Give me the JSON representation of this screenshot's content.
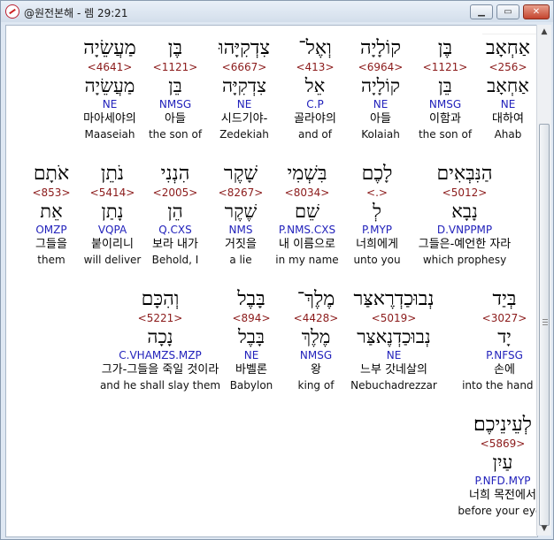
{
  "window": {
    "title": "@원전본해 - 렘 29:21",
    "min_glyph": "▁",
    "max_glyph": "▭",
    "close_glyph": "✕"
  },
  "scrollbar": {
    "up": "▲",
    "down": "▼"
  },
  "rows": [
    [
      {
        "heb": "אַחְאָב",
        "strong": "<256>",
        "lemma": "אַחְאָב",
        "parse": "NE",
        "kor": "대하여",
        "eng": "Ahab"
      },
      {
        "heb": "בֶּן",
        "strong": "<1121>",
        "lemma": "בֵּן",
        "parse": "NMSG",
        "kor": "이함과",
        "eng": "the son of"
      },
      {
        "heb": "קוֹלָיָה",
        "strong": "<6964>",
        "lemma": "קוֹלָיָה",
        "parse": "NE",
        "kor": "아들",
        "eng": "Kolaiah"
      },
      {
        "heb": "וְאֶל־",
        "strong": "<413>",
        "lemma": "אֵל",
        "parse": "C.P",
        "kor": "골라야의",
        "eng": "and of"
      },
      {
        "heb": "צִדְקִיָּהוּ",
        "strong": "<6667>",
        "lemma": "צִדְקִיָּה",
        "parse": "NE",
        "kor": "시드기야-",
        "eng": "Zedekiah"
      },
      {
        "heb": "בֶּן",
        "strong": "<1121>",
        "lemma": "בֵּן",
        "parse": "NMSG",
        "kor": "아들",
        "eng": "the son of"
      },
      {
        "heb": "מַעֲשֵׂיָה",
        "strong": "<4641>",
        "lemma": "מַעֲשֵׂיָה",
        "parse": "NE",
        "kor": "마아세야의",
        "eng": "Maaseiah"
      }
    ],
    [
      {
        "heb": "הַנִּבְּאִים",
        "strong": "<5012>",
        "lemma": "נָבָא",
        "parse": "D.VNPPMP",
        "kor": "그들은-예언한 자라",
        "eng": "which prophesy"
      },
      {
        "heb": "לָכֶם",
        "strong": "<.>",
        "lemma": "לְ",
        "parse": "P.MYP",
        "kor": "너희에게",
        "eng": "unto you"
      },
      {
        "heb": "בִּשְׁמִי",
        "strong": "<8034>",
        "lemma": "שֵׁם",
        "parse": "P.NMS.CXS",
        "kor": "내 이름으로",
        "eng": "in my name"
      },
      {
        "heb": "שָׁקֶר",
        "strong": "<8267>",
        "lemma": "שֶׁקֶר",
        "parse": "NMS",
        "kor": "거짓을",
        "eng": "a lie"
      },
      {
        "heb": "הִנְנִי",
        "strong": "<2005>",
        "lemma": "הֵן",
        "parse": "Q.CXS",
        "kor": "보라 내가",
        "eng": "Behold, I"
      },
      {
        "heb": "נֹתֵן",
        "strong": "<5414>",
        "lemma": "נָתַן",
        "parse": "VQPA",
        "kor": "붙이리니",
        "eng": "will deliver"
      },
      {
        "heb": "אֹתָם",
        "strong": "<853>",
        "lemma": "אֵת",
        "parse": "OMZP",
        "kor": "그들을",
        "eng": "them"
      }
    ],
    [
      {
        "heb": "בְּיַד",
        "strong": "<3027>",
        "lemma": "יָד",
        "parse": "P.NFSG",
        "kor": "손에",
        "eng": "into the hand of"
      },
      {
        "heb": "נְבוּכַדְרֶאצַּר",
        "strong": "<5019>",
        "lemma": "נְבוּכַדְנֶאצַּר",
        "parse": "NE",
        "kor": "느부 갓네살의",
        "eng": "Nebuchadrezzar"
      },
      {
        "heb": "מֶלֶךְ־",
        "strong": "<4428>",
        "lemma": "מֶלֶךְ",
        "parse": "NMSG",
        "kor": "왕",
        "eng": "king of"
      },
      {
        "heb": "בָּבֶל",
        "strong": "<894>",
        "lemma": "בָּבֶל",
        "parse": "NE",
        "kor": "바벨론",
        "eng": "Babylon"
      },
      {
        "heb": "וְהִכָּם",
        "strong": "<5221>",
        "lemma": "נָכָה",
        "parse": "C.VHAMZS.MZP",
        "kor": "그가-그들을 죽일 것이라",
        "eng": "and he shall slay them"
      }
    ],
    [
      {
        "heb": "לְעֵינֵיכֶם׃",
        "strong": "<5869>",
        "lemma": "עַיִן",
        "parse": "P.NFD.MYP",
        "kor": "너희 목전에서",
        "eng": "before your eyes"
      }
    ]
  ]
}
